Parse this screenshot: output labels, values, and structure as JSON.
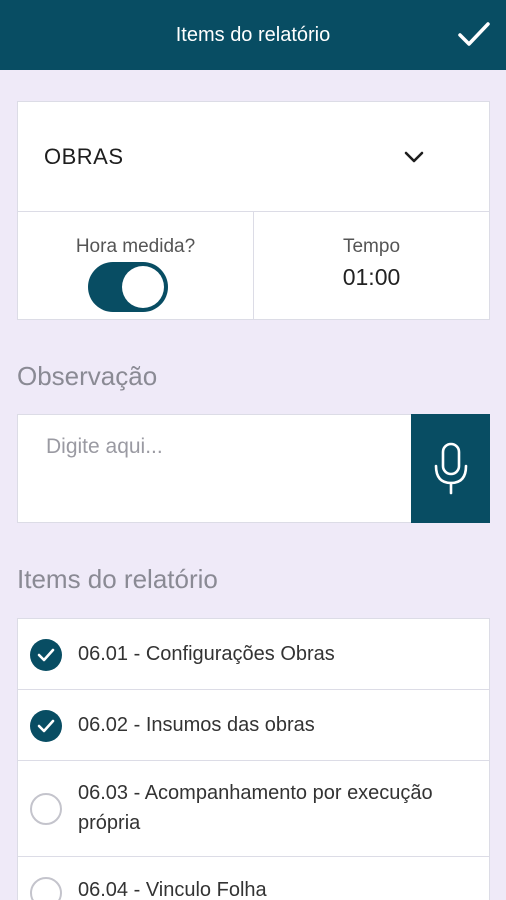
{
  "appbar": {
    "title": "Items do relatório",
    "confirm_icon": "check-icon"
  },
  "category_select": {
    "value": "OBRAS",
    "icon": "chevron-down-icon"
  },
  "hora_medida": {
    "label": "Hora medida?",
    "enabled": true
  },
  "tempo": {
    "label": "Tempo",
    "value": "01:00"
  },
  "observacao": {
    "title": "Observação",
    "placeholder": "Digite aqui...",
    "value": "",
    "mic_icon": "microphone-icon"
  },
  "items_section": {
    "title": "Items do relatório",
    "items": [
      {
        "label": "06.01 - Configurações Obras",
        "checked": true
      },
      {
        "label": "06.02 - Insumos das obras",
        "checked": true
      },
      {
        "label": "06.03 - Acompanhamento por execução própria",
        "checked": false
      },
      {
        "label": "06.04 - Vinculo Folha",
        "checked": false
      }
    ]
  },
  "colors": {
    "primary": "#084d63",
    "background": "#efeaf8"
  }
}
